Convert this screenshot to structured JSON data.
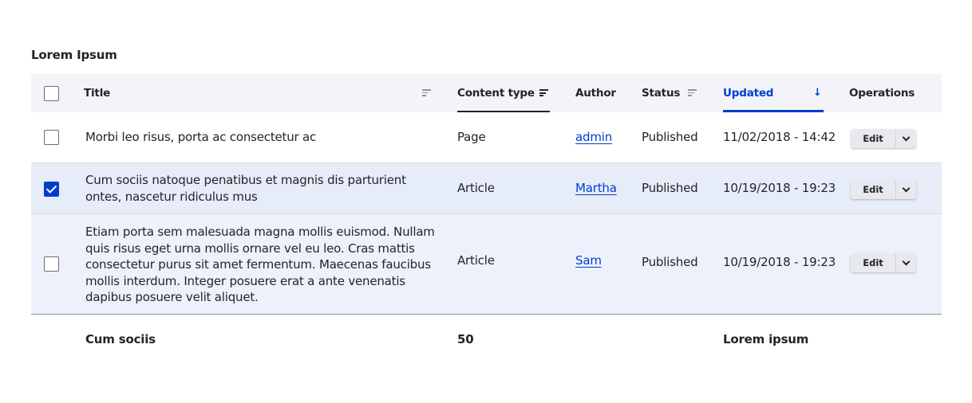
{
  "caption": "Lorem Ipsum",
  "columns": {
    "title": "Title",
    "content_type": "Content type",
    "author": "Author",
    "status": "Status",
    "updated": "Updated",
    "operations": "Operations"
  },
  "rows": [
    {
      "checked": false,
      "title": "Morbi leo risus, porta ac consectetur ac",
      "content_type": "Page",
      "author": "admin",
      "status": "Published",
      "updated": "11/02/2018 - 14:42",
      "edit_label": "Edit"
    },
    {
      "checked": true,
      "title": "Cum sociis natoque penatibus et magnis dis parturient ontes, nascetur ridiculus mus",
      "content_type": "Article",
      "author": "Martha",
      "status": "Published",
      "updated": "10/19/2018 - 19:23",
      "edit_label": "Edit"
    },
    {
      "checked": false,
      "title": "Etiam porta sem malesuada magna mollis euismod. Nullam quis risus eget urna mollis ornare vel eu leo. Cras mattis consectetur purus sit amet fermentum. Maecenas faucibus mollis interdum. Integer posuere erat a ante venenatis dapibus posuere velit aliquet.",
      "content_type": "Article",
      "author": "Sam",
      "status": "Published",
      "updated": "10/19/2018 - 19:23",
      "edit_label": "Edit"
    }
  ],
  "footer": {
    "title": "Cum sociis",
    "content_type": "50",
    "updated": "Lorem ipsum"
  },
  "colors": {
    "accent": "#003ecc",
    "header_bg": "#f3f4f9",
    "selected_row_bg": "#e6ecf8"
  },
  "icons": {
    "sort": "sort-lines-icon",
    "sort_desc": "arrow-down-icon",
    "dropdown": "chevron-down-icon"
  }
}
